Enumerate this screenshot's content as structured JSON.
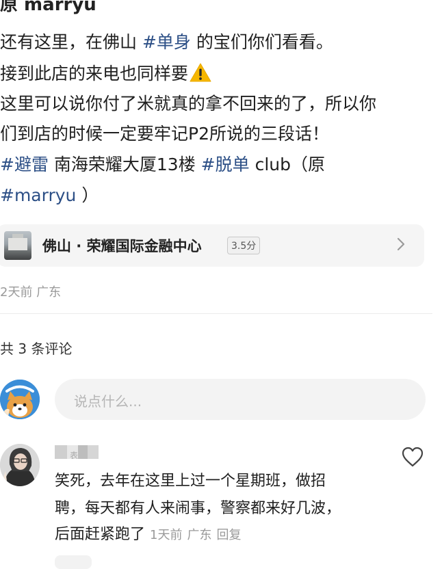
{
  "post": {
    "top_title": "原 marryu",
    "line1_a": "还有这里，在佛山 ",
    "line1_tag": "#单身",
    "line1_b": " 的宝们你们看看。",
    "line2": "接到此店的来电也同样要",
    "line2_icon": "warning-icon",
    "line3": "这里可以说你付了米就真的拿不回来的了，所以你",
    "line4": "们到店的时候一定要牢记P2所说的三段话！",
    "line5_tag1": " #避雷",
    "line5_mid": "  南海荣耀大厦13楼 ",
    "line5_tag2": "#脱单",
    "line5_end": "  club（原",
    "line6_tag": "#marryu",
    "line6_end": " ）"
  },
  "location_card": {
    "title": "佛山 · 荣耀国际金融中心",
    "score": "3.5分",
    "thumb_icon": "building-thumbnail",
    "chevron_icon": "chevron-right-icon"
  },
  "post_meta": "2天前 广东",
  "comments_section": {
    "count_label": "共 3 条评论",
    "input_placeholder": "说点什么...",
    "comments": [
      {
        "name_hint": "表",
        "line1": "笑死，去年在这里上过一个星期班，做招",
        "line2": "聘，每天都有人来闹事，警察都来好几波，",
        "line3": "后面赶紧跑了",
        "time": "1天前",
        "region": "广东",
        "reply": "回复"
      }
    ]
  },
  "colors": {
    "hashtag": "#2c4f86",
    "meta_gray": "#9a9a9a",
    "card_bg": "#f5f5f5",
    "input_bg": "#f3f3f3"
  }
}
